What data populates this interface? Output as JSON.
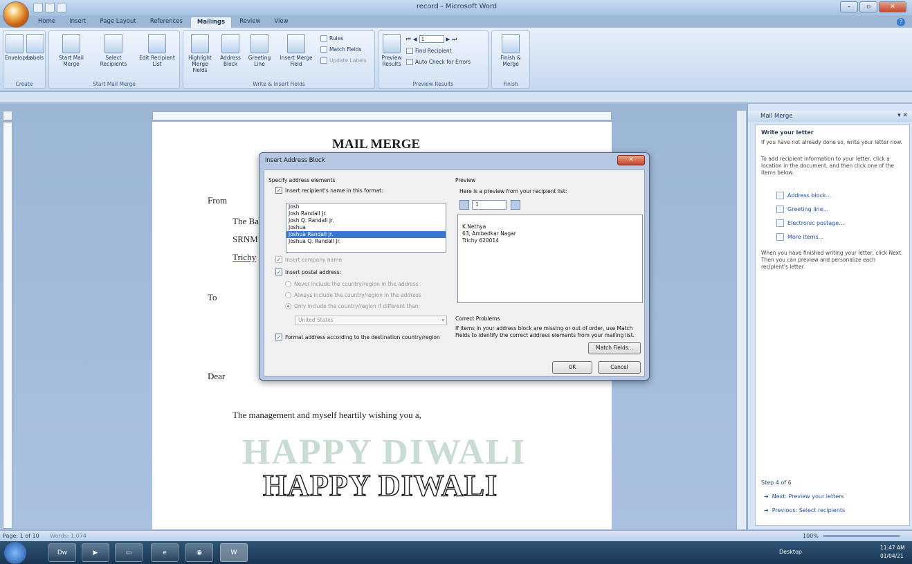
{
  "window": {
    "title": "record - Microsoft Word"
  },
  "tabs": [
    "Home",
    "Insert",
    "Page Layout",
    "References",
    "Mailings",
    "Review",
    "View"
  ],
  "ribbon": {
    "create": {
      "label": "Create",
      "buttons": [
        "Envelopes",
        "Labels"
      ]
    },
    "start": {
      "label": "Start Mail Merge",
      "buttons": [
        "Start Mail Merge",
        "Select Recipients",
        "Edit Recipient List"
      ]
    },
    "write": {
      "label": "Write & Insert Fields",
      "buttons": [
        "Highlight Merge Fields",
        "Address Block",
        "Greeting Line",
        "Insert Merge Field"
      ],
      "small": [
        "Rules",
        "Match Fields",
        "Update Labels"
      ]
    },
    "preview": {
      "label": "Preview Results",
      "buttons": [
        "Preview Results"
      ],
      "small": [
        "Find Recipient",
        "Auto Check for Errors"
      ],
      "record": "1"
    },
    "finish": {
      "label": "Finish",
      "buttons": [
        "Finish & Merge"
      ]
    }
  },
  "document": {
    "title": "MAIL MERGE",
    "from": "From",
    "from_lines": [
      "The Ba",
      "SRNM",
      "Trichy"
    ],
    "to": "To",
    "dear": "Dear",
    "body": "The management and myself heartily wishing you a,",
    "banner": "HAPPY DIWALI",
    "banner_shadow": "HAPPY DIWALI"
  },
  "dialog": {
    "title": "Insert Address Block",
    "specify": "Specify address elements",
    "name_format_label": "Insert recipient's name in this format:",
    "name_formats": [
      "Josh",
      "Josh Randall Jr.",
      "Josh Q. Randall Jr.",
      "Joshua",
      "Joshua Randall Jr.",
      "Joshua Q. Randall Jr."
    ],
    "selected_index": 4,
    "company": "Insert company name",
    "postal": "Insert postal address:",
    "radio1": "Never include the country/region in the address",
    "radio2": "Always include the country/region in the address",
    "radio3": "Only include the country/region if different than:",
    "country": "United States",
    "format_by_dest": "Format address according to the destination country/region",
    "preview_label": "Preview",
    "preview_hint": "Here is a preview from your recipient list:",
    "preview_record": "1",
    "preview_lines": [
      "K.Nethya",
      "63, Ambedkar Nagar",
      "Trichy 620014"
    ],
    "correct_title": "Correct Problems",
    "correct_text": "If items in your address block are missing or out of order, use Match Fields to identify the correct address elements from your mailing list.",
    "match_btn": "Match Fields...",
    "ok": "OK",
    "cancel": "Cancel"
  },
  "pane": {
    "title": "Mail Merge",
    "heading": "Write your letter",
    "text1": "If you have not already done so, write your letter now.",
    "text2": "To add recipient information to your letter, click a location in the document, and then click one of the items below.",
    "links": [
      "Address block...",
      "Greeting line...",
      "Electronic postage...",
      "More items..."
    ],
    "text3": "When you have finished writing your letter, click Next. Then you can preview and personalize each recipient's letter.",
    "step": "Step 4 of 6",
    "next": "Next: Preview your letters",
    "prev": "Previous: Select recipients"
  },
  "status": {
    "page": "Page: 1 of 10",
    "words": "Words: 1,074",
    "zoom": "100%"
  },
  "taskbar": {
    "desktop": "Desktop",
    "time": "11:47 AM",
    "date": "01/04/21"
  }
}
